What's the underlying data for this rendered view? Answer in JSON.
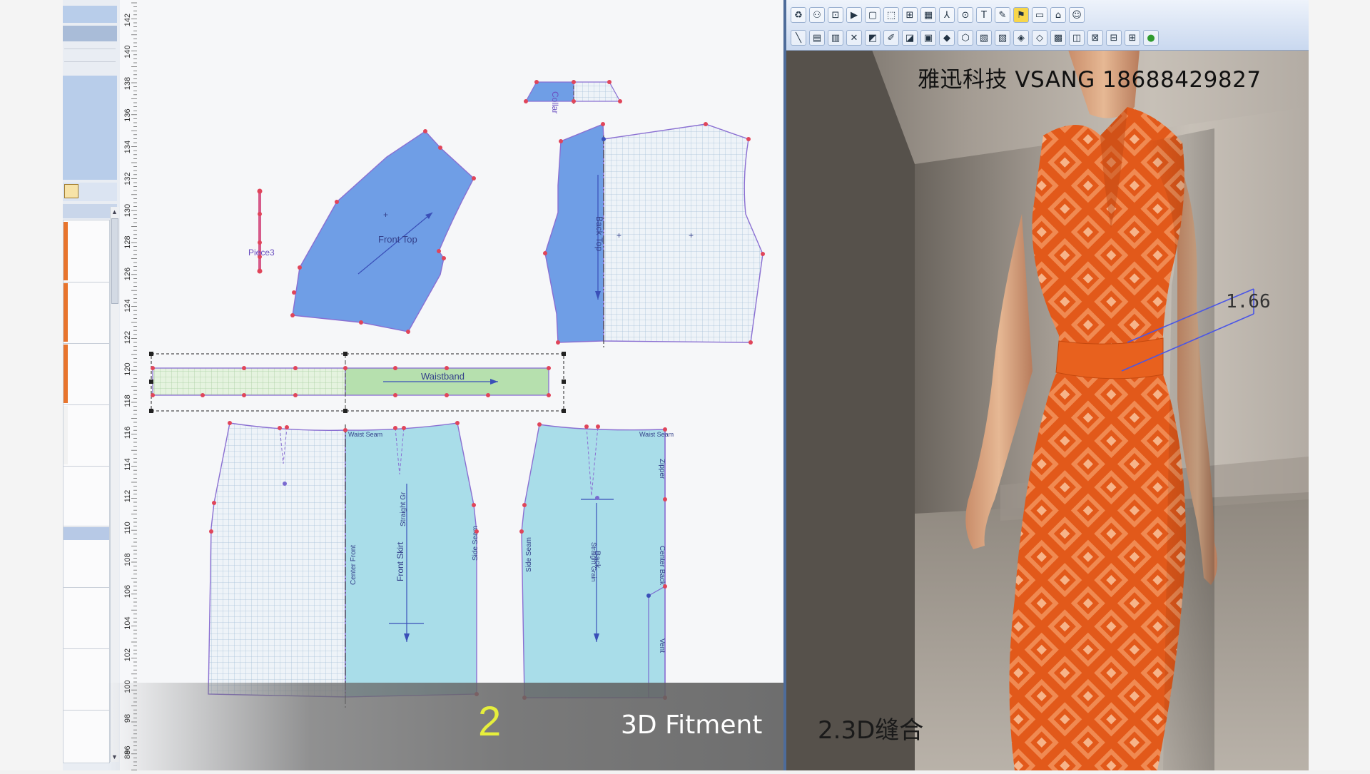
{
  "colors": {
    "front_piece": "#6f9ee6",
    "skirt_piece": "#a9dde9",
    "waistband": "#b6e0ae",
    "outline": "#8a6fd2",
    "point": "#e0455a",
    "dress": "#e3601c",
    "caption_accent": "#e6ef3c"
  },
  "ruler": {
    "ticks": [
      "142",
      "140",
      "138",
      "136",
      "134",
      "132",
      "130",
      "128",
      "126",
      "124",
      "122",
      "120",
      "118",
      "116",
      "114",
      "112",
      "110",
      "108",
      "106",
      "104",
      "102",
      "100",
      "98",
      "96",
      "94",
      "88"
    ]
  },
  "pieces": {
    "collar": "Collar",
    "front_top": "Front Top",
    "piece3": "Piece3",
    "back_top": "Back Top",
    "waistband": "Waistband",
    "waist_seam_front": "Waist Seam",
    "center_front": "Center Front",
    "front_skirt": "Front Skirt",
    "straight_grain_front": "Straight Gr",
    "side_seam_front": "Side Seam",
    "waist_seam_back": "Waist Seam",
    "side_seam_back": "Side Seam",
    "straight_grain_back": "Straight Grain",
    "back": "Back",
    "zipper": "Zipper",
    "center_back": "Center Back",
    "vent": "Vent"
  },
  "view3d": {
    "watermark": "雅迅科技  VSANG 18688429827",
    "measurement": "1.66",
    "toolbar_row1": [
      "recycle-icon",
      "figure-icon",
      "fit-icon",
      "play-icon",
      "frame-icon",
      "bound-icon",
      "grid-icon",
      "shade-icon",
      "axis-icon",
      "zoom-icon",
      "text-icon",
      "pen-icon",
      "marker-icon",
      "display-icon",
      "camera-icon",
      "user-icon"
    ],
    "toolbar_row2": [
      "line-icon",
      "tile-icon",
      "tile2-icon",
      "cross-icon",
      "select-icon",
      "edit-icon",
      "piece-icon",
      "stack-icon",
      "shape-icon",
      "morph-icon",
      "box-icon",
      "panel-icon",
      "cube-icon",
      "cube2-icon",
      "layer-icon",
      "layer2-icon",
      "mesh-icon",
      "mesh2-icon",
      "grid3-icon",
      "sphere-icon"
    ]
  },
  "caption": {
    "number": "2",
    "english": "3D Fitment",
    "chinese": "2.3D缝合"
  }
}
